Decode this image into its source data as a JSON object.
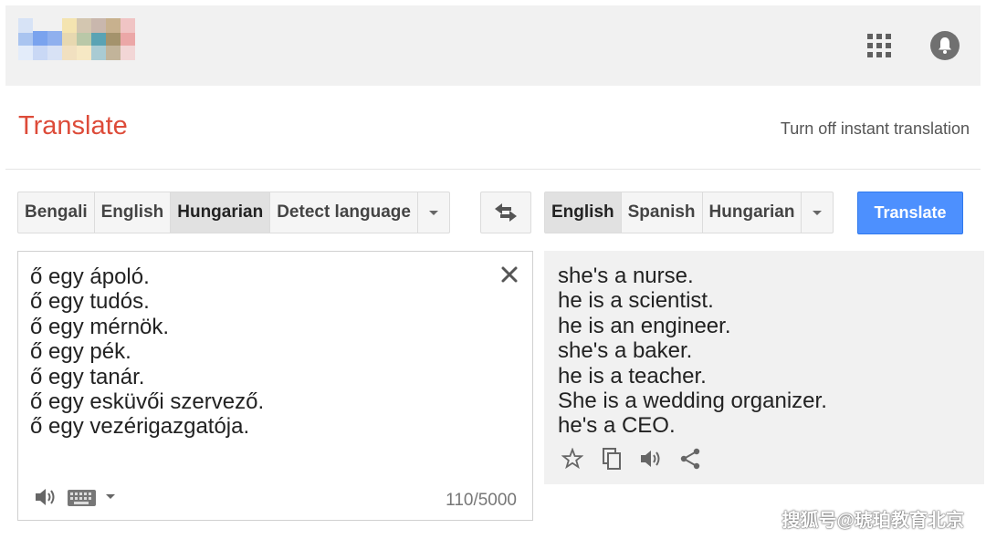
{
  "app": {
    "title": "Translate",
    "instant_link": "Turn off instant translation"
  },
  "header": {
    "apps_icon": "apps-grid-icon",
    "notifications_icon": "bell-icon"
  },
  "source": {
    "languages": [
      {
        "label": "Bengali",
        "selected": false
      },
      {
        "label": "English",
        "selected": false
      },
      {
        "label": "Hungarian",
        "selected": true
      },
      {
        "label": "Detect language",
        "selected": false
      }
    ],
    "text_lines": [
      "ő egy ápoló.",
      "ő egy tudós.",
      "ő egy mérnök.",
      "ő egy pék.",
      "ő egy tanár.",
      "ő egy esküvői szervező.",
      "ő egy vezérigazgatója."
    ],
    "char_count": "110/5000"
  },
  "target": {
    "languages": [
      {
        "label": "English",
        "selected": true
      },
      {
        "label": "Spanish",
        "selected": false
      },
      {
        "label": "Hungarian",
        "selected": false
      }
    ],
    "text_lines": [
      "she's a nurse.",
      "he is a scientist.",
      "he is an engineer.",
      "she's a baker.",
      "he is a teacher.",
      "She is a wedding organizer.",
      "he's a CEO."
    ]
  },
  "buttons": {
    "translate": "Translate"
  },
  "watermark": "搜狐号@琥珀教育北京",
  "colors": {
    "title": "#dd4b39",
    "translate_button": "#4d90fe",
    "target_background": "#f1f1f1"
  }
}
